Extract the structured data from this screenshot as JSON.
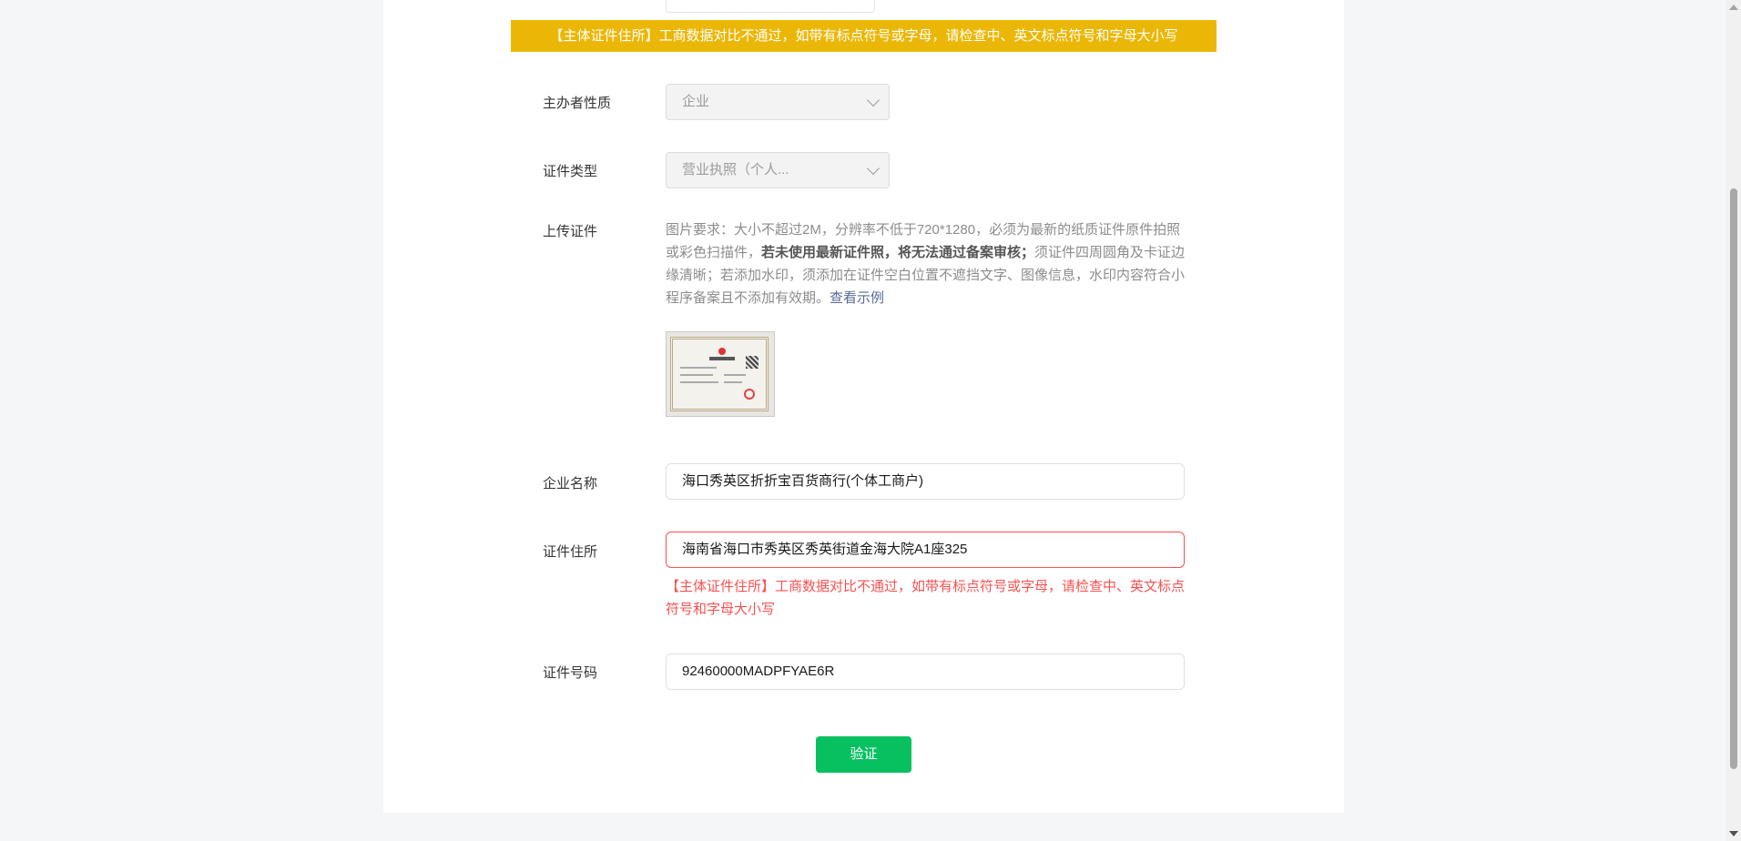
{
  "banner": {
    "text": "【主体证件住所】工商数据对比不通过，如带有标点符号或字母，请检查中、英文标点符号和字母大小写",
    "color": "#ebb707"
  },
  "form": {
    "organizer_type": {
      "label": "主办者性质",
      "value": "企业"
    },
    "cert_type": {
      "label": "证件类型",
      "value": "营业执照（个人..."
    },
    "upload": {
      "label": "上传证件",
      "hint_part1": "图片要求：大小不超过2M，分辨率不低于720*1280，必须为最新的纸质证件原件拍照或彩色扫描件，",
      "hint_bold": "若未使用最新证件照，将无法通过备案审核；",
      "hint_part2": "须证件四周圆角及卡证边缘清晰；若添加水印，须添加在证件空白位置不遮挡文字、图像信息，水印内容符合小程序备案且不添加有效期。",
      "example_link": "查看示例"
    },
    "company_name": {
      "label": "企业名称",
      "value": "海口秀英区折折宝百货商行(个体工商户)"
    },
    "cert_address": {
      "label": "证件住所",
      "value": "海南省海口市秀英区秀英街道金海大院A1座325",
      "error": "【主体证件住所】工商数据对比不通过，如带有标点符号或字母，请检查中、英文标点符号和字母大小写"
    },
    "cert_number": {
      "label": "证件号码",
      "value": "92460000MADPFYAE6R"
    },
    "verify_button": "验证"
  },
  "colors": {
    "primary_button": "#07c160",
    "error": "#fa5151",
    "link": "#576b95"
  }
}
